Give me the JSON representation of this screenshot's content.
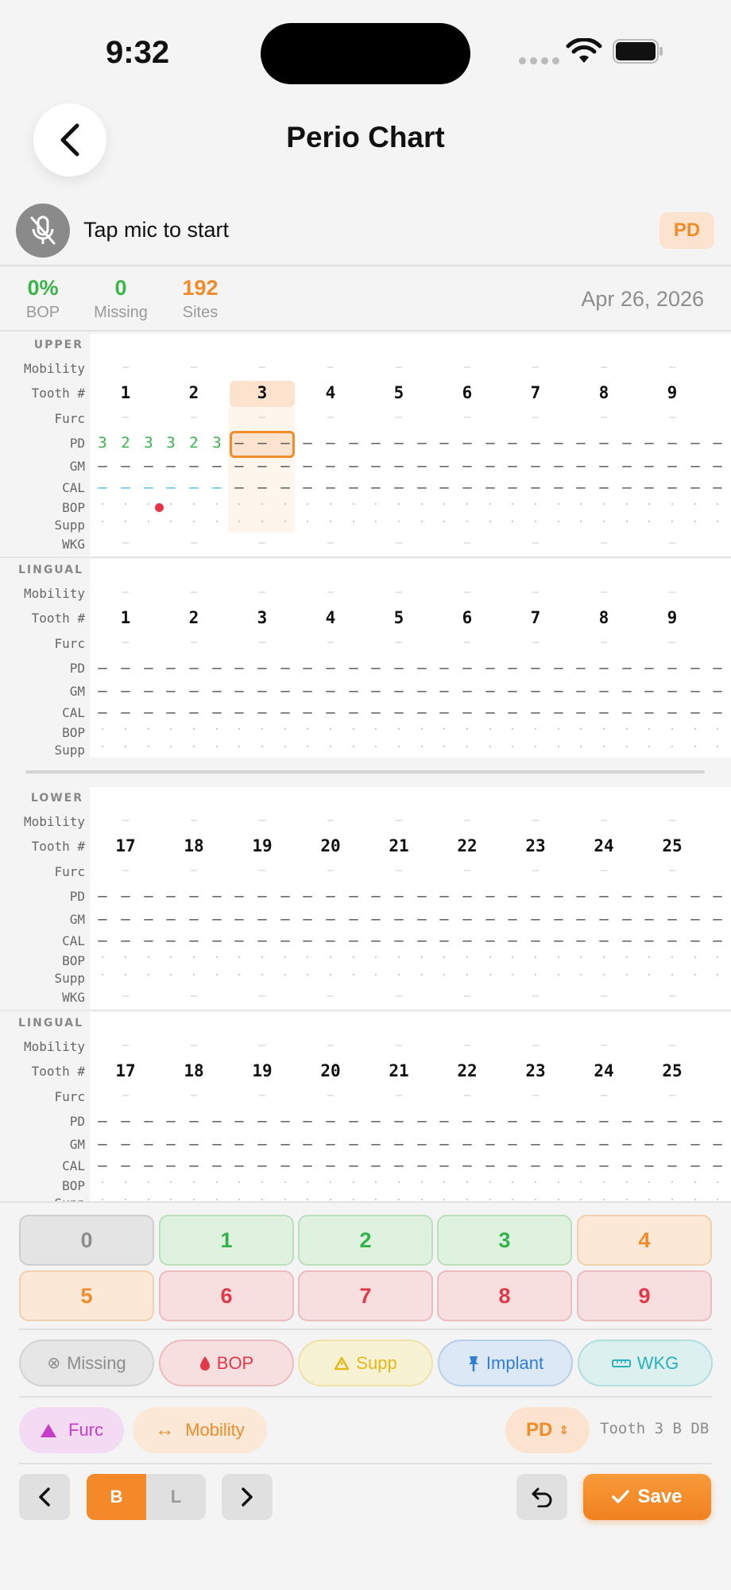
{
  "status": {
    "time": "9:32"
  },
  "nav": {
    "title": "Perio Chart"
  },
  "voice": {
    "prompt": "Tap mic to start",
    "mode": "PD"
  },
  "stats": {
    "bop": {
      "value": "0%",
      "label": "BOP"
    },
    "missing": {
      "value": "0",
      "label": "Missing"
    },
    "sites": {
      "value": "192",
      "label": "Sites"
    },
    "date": "Apr 26, 2026"
  },
  "row_labels": {
    "mobility": "Mobility",
    "tooth": "Tooth #",
    "furc": "Furc",
    "pd": "PD",
    "gm": "GM",
    "cal": "CAL",
    "bop": "BOP",
    "supp": "Supp",
    "wkg": "WKG"
  },
  "sections": [
    {
      "title": "UPPER",
      "teeth": [
        "1",
        "2",
        "3",
        "4",
        "5",
        "6",
        "7",
        "8",
        "9"
      ]
    },
    {
      "title": "LINGUAL",
      "teeth": [
        "1",
        "2",
        "3",
        "4",
        "5",
        "6",
        "7",
        "8",
        "9"
      ]
    },
    {
      "title": "LOWER",
      "teeth": [
        "17",
        "18",
        "19",
        "20",
        "21",
        "22",
        "23",
        "24",
        "25"
      ]
    },
    {
      "title": "LINGUAL",
      "teeth": [
        "17",
        "18",
        "19",
        "20",
        "21",
        "22",
        "23",
        "24",
        "25"
      ]
    }
  ],
  "recorded_pd": {
    "tooth_1": [
      "3",
      "2",
      "3"
    ],
    "tooth_2": [
      "3",
      "2",
      "3"
    ]
  },
  "placeholders": {
    "dash": "–",
    "dot": "·",
    "mini_dash": "—"
  },
  "keypad": [
    "0",
    "1",
    "2",
    "3",
    "4",
    "5",
    "6",
    "7",
    "8",
    "9"
  ],
  "flags": {
    "missing": "Missing",
    "bop": "BOP",
    "supp": "Supp",
    "implant": "Implant",
    "wkg": "WKG"
  },
  "tools": {
    "furc": "Furc",
    "mobility": "Mobility",
    "mode": "PD",
    "cursor": "Tooth 3 B DB"
  },
  "surface": {
    "buccal": "B",
    "lingual": "L"
  },
  "actions": {
    "save": "Save"
  },
  "colors": {
    "accent": "#f08c2a",
    "green": "#39b54a",
    "red": "#e03a48",
    "cyan": "#3db9d8"
  }
}
